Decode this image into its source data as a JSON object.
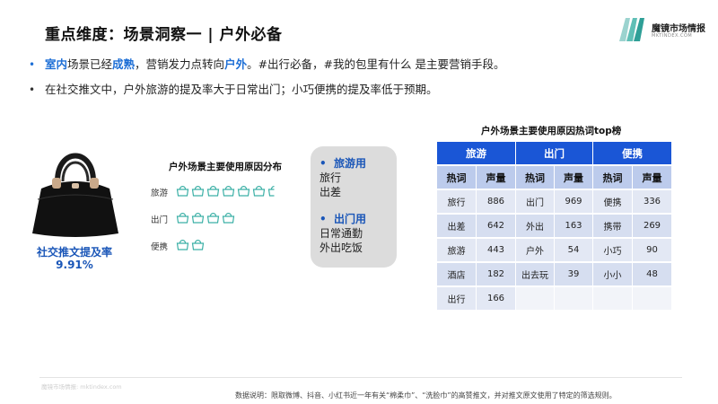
{
  "header": {
    "title": "重点维度：场景洞察一 | 户外必备",
    "logo_name": "魔镜市场情报",
    "logo_sub": "MKTINDEX.COM"
  },
  "bullets": {
    "b1_part1": "室内",
    "b1_part2": "场景已经",
    "b1_part3": "成熟",
    "b1_part4": "，营销发力点转向",
    "b1_part5": "户外",
    "b1_part6": "。#出行必备，#我的包里有什么 是主要营销手段。",
    "b2": "在社交推文中，户外旅游的提及率大于日常出门；小巧便携的提及率低于预期。",
    "dot": "•"
  },
  "stat": {
    "label": "社交推文提及率",
    "value": "9.91%"
  },
  "distribution": {
    "title": "户外场景主要使用原因分布",
    "rows": [
      {
        "label": "旅游",
        "count": 6.5
      },
      {
        "label": "出门",
        "count": 4
      },
      {
        "label": "便携",
        "count": 2
      }
    ]
  },
  "callout": {
    "head1": "旅游用",
    "item1a": "旅行",
    "item1b": "出差",
    "head2": "出门用",
    "item2a": "日常通勤",
    "item2b": "外出吃饭"
  },
  "table": {
    "title": "户外场景主要使用原因热词top榜",
    "groups": [
      "旅游",
      "出门",
      "便携"
    ],
    "subheaders": [
      "热词",
      "声量",
      "热词",
      "声量",
      "热词",
      "声量"
    ],
    "rows": [
      [
        "旅行",
        "886",
        "出门",
        "969",
        "便携",
        "336"
      ],
      [
        "出差",
        "642",
        "外出",
        "163",
        "携带",
        "269"
      ],
      [
        "旅游",
        "443",
        "户外",
        "54",
        "小巧",
        "90"
      ],
      [
        "酒店",
        "182",
        "出去玩",
        "39",
        "小小",
        "48"
      ],
      [
        "出行",
        "166",
        "",
        "",
        "",
        ""
      ]
    ]
  },
  "footer": {
    "source": "魔镜市场情报: mktindex.com",
    "note": "数据说明：限取微博、抖音、小红书近一年有关“棉柔巾”、“洗脸巾”的高赞推文，并对推文原文使用了特定的筛选规则。"
  },
  "colors": {
    "accent": "#1a56d6",
    "icon": "#3cb0a6"
  }
}
